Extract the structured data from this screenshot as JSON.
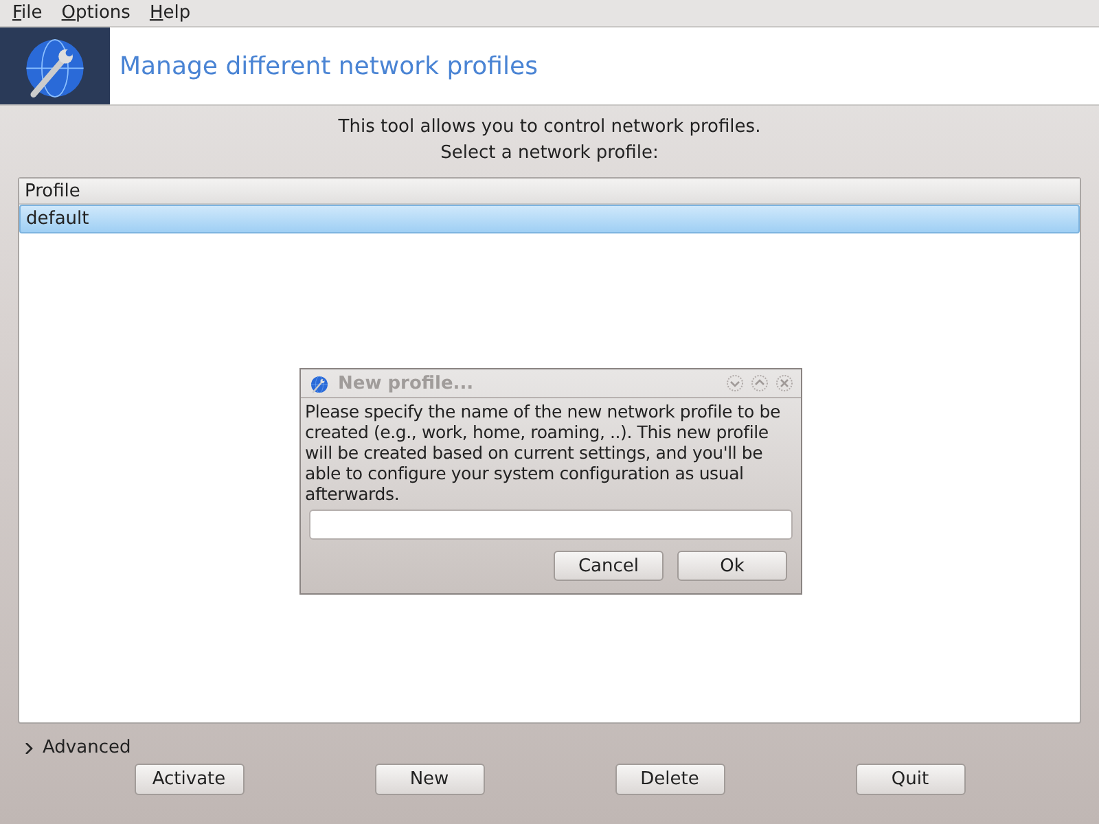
{
  "menu": [
    "File",
    "Options",
    "Help"
  ],
  "header": {
    "title": "Manage different network profiles"
  },
  "intro": [
    "This tool allows you to control network profiles.",
    "Select a network profile:"
  ],
  "table": {
    "columns": [
      "Profile"
    ],
    "rows": [
      {
        "cells": [
          "default"
        ],
        "selected": true
      }
    ]
  },
  "dialog": {
    "title": "New profile...",
    "message": "Please specify the name of the new network profile to be created (e.g., work, home, roaming, ..). This new profile will be created based on current settings, and you'll be able to configure your system configuration as usual afterwards.",
    "buttons": [
      "Cancel",
      "Ok"
    ]
  },
  "advanced": {
    "label": "Advanced",
    "expanded": false
  },
  "buttons": [
    "Activate",
    "New",
    "Delete",
    "Quit"
  ]
}
